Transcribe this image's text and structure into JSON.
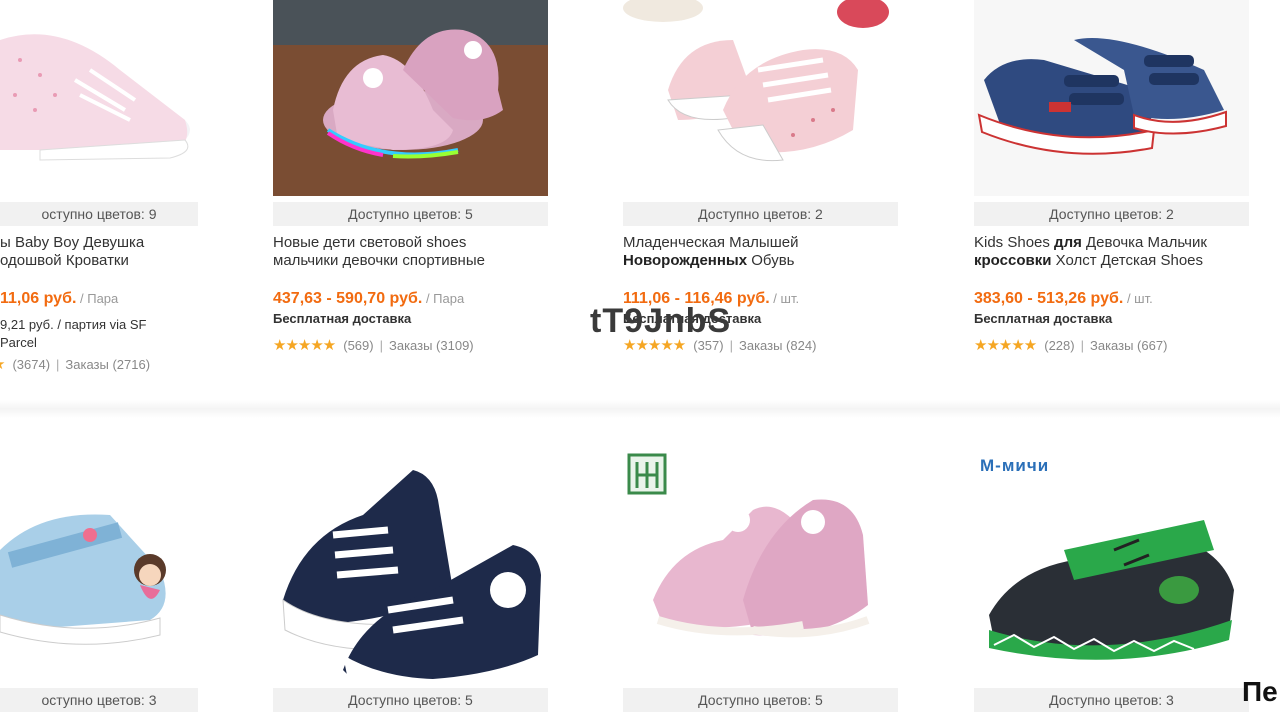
{
  "watermark": "tT9JnbS",
  "corner_text": "Пе",
  "row1": [
    {
      "colors_label": "оступно цветов: 9",
      "title_line1": "ы Baby Boy Девушка",
      "title_line2": "одошвой Кроватки",
      "price": "11,06 руб.",
      "unit": " / Пара",
      "shipping_line1": "9,21 руб. / партия via SF",
      "shipping_line2": "Parcel",
      "rating_count": "(3674)",
      "orders": "Заказы (2716)"
    },
    {
      "colors_label": "Доступно цветов: 5",
      "title_line1": "Новые дети световой shoes",
      "title_line2": "мальчики девочки спортивные",
      "price": "437,63 - 590,70 руб.",
      "unit": " / Пара",
      "shipping_line1": "Бесплатная доставка",
      "rating_count": "(569)",
      "orders": "Заказы (3109)"
    },
    {
      "colors_label": "Доступно цветов: 2",
      "title_line1": "Младенческая Малышей",
      "title_line2_bold": "Новорожденных",
      "title_line2_rest": " Обувь",
      "price": "111,06 - 116,46 руб.",
      "unit": " / шт.",
      "shipping_line1": "Бесплатная доставка",
      "rating_count": "(357)",
      "orders": "Заказы (824)"
    },
    {
      "colors_label": "Доступно цветов: 2",
      "title_line1_a": "Kids Shoes ",
      "title_line1_bold": "для",
      "title_line1_b": " Девочка Мальчик",
      "title_line2_bold": "кроссовки",
      "title_line2_rest": " Холст Детская Shoes",
      "price": "383,60 - 513,26 руб.",
      "unit": " / шт.",
      "shipping_line1": "Бесплатная доставка",
      "rating_count": "(228)",
      "orders": "Заказы (667)"
    }
  ],
  "row2": [
    {
      "colors_label": "оступно цветов: 3"
    },
    {
      "colors_label": "Доступно цветов: 5"
    },
    {
      "colors_label": "Доступно цветов: 5",
      "brand": "ℍ"
    },
    {
      "colors_label": "Доступно цветов: 3",
      "brand": "М-мичи"
    }
  ],
  "stars": "★★★★★",
  "colors": {
    "price": "#f26b10",
    "stars": "#f5a623"
  }
}
